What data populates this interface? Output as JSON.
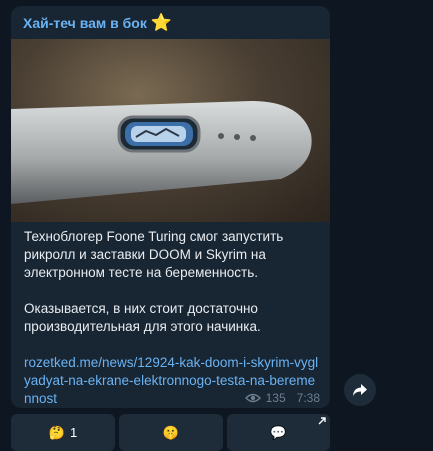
{
  "post": {
    "channel_name": "Хай-теч вам в бок",
    "channel_emoji": "⭐",
    "paragraph1": "Техноблогер Foone Turing смог запустить рикролл и заставки DOOM и Skyrim на электронном тесте на беременность.",
    "paragraph2": "Оказывается, в них стоит достаточно производительная для этого начинка.",
    "link": "rozetked.me/news/12924-kak-doom-i-skyrim-vyglyadyat-na-ekrane-elektronnogo-testa-na-beremennost",
    "views": "135",
    "time": "7:38"
  },
  "reactions": [
    {
      "emoji": "🤔",
      "count": "1"
    },
    {
      "emoji": "🤫",
      "count": ""
    },
    {
      "emoji": "💬",
      "count": ""
    }
  ],
  "icons": {
    "views": "eye-icon",
    "share": "share-icon",
    "corner": "arrow-corner-icon"
  },
  "colors": {
    "background": "#0e1621",
    "bubble": "#182533",
    "accent": "#6ab3f3",
    "text": "#e9edf1",
    "muted": "#6d7f8f"
  }
}
